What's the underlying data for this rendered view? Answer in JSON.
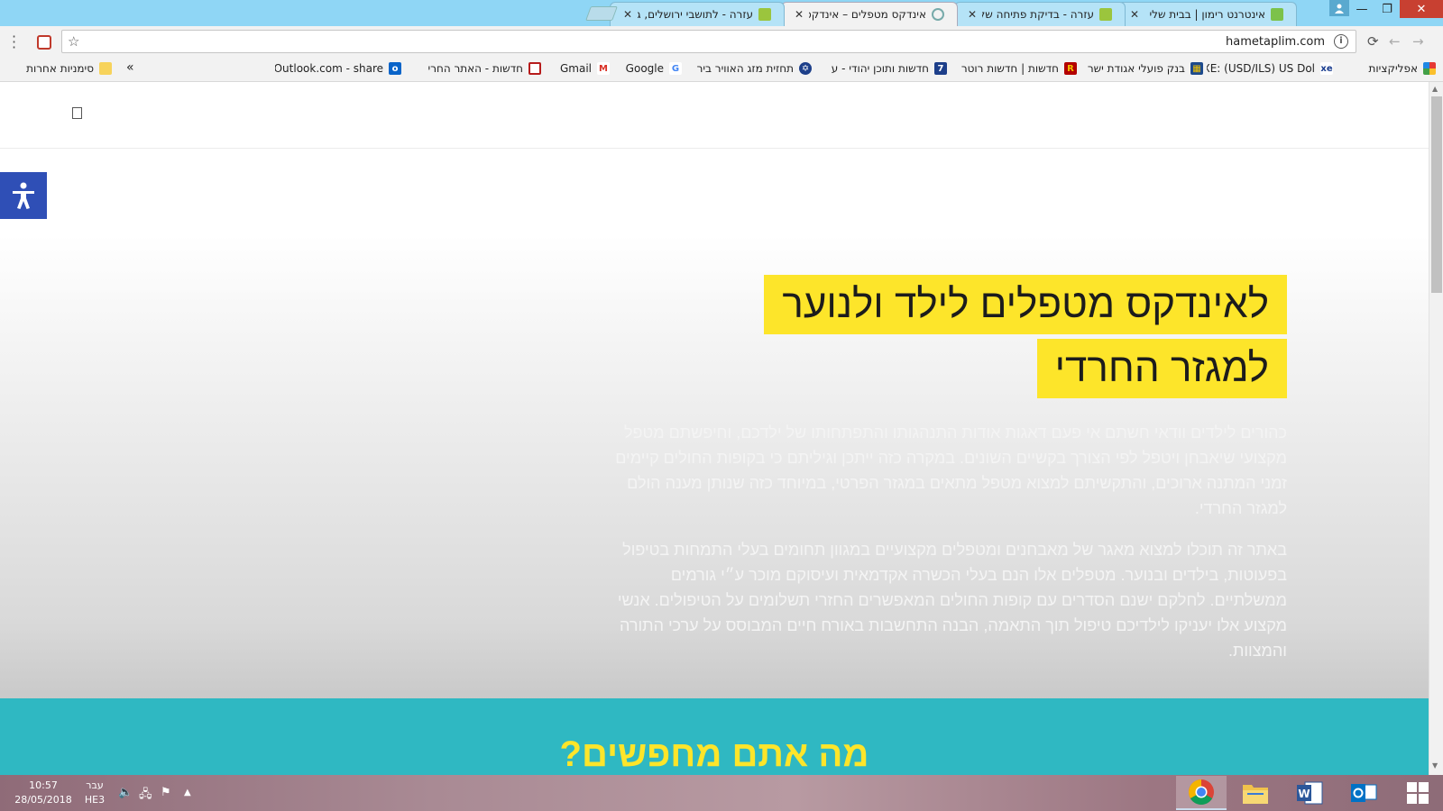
{
  "browser": {
    "tabs": [
      {
        "title": "אינטרנט רימון | בבית שלי"
      },
      {
        "title": "עזרה - בדיקת פתיחה של"
      },
      {
        "title": "אינדקס מטפלים – אינדקס"
      },
      {
        "title": "עזרה - לתושבי ירושלים, ג"
      }
    ],
    "close_glyph": "✕",
    "url": "hametaplim.com",
    "bookmarks": [
      {
        "label": "אפליקציות"
      },
      {
        "label": "XE: (USD/ILS) US Dol"
      },
      {
        "label": "בנק פועלי אגודת ישר"
      },
      {
        "label": "חדשות | חדשות רוטר"
      },
      {
        "label": "חדשות ותוכן יהודי - ע"
      },
      {
        "label": "תחזית מזג האוויר ביר"
      },
      {
        "label": "Google"
      },
      {
        "label": "Gmail"
      },
      {
        "label": "חדשות - האתר החרי"
      },
      {
        "label": "Outlook.com - share"
      }
    ],
    "bookmarks_overflow": "»",
    "other_bookmarks": "סימניות אחרות"
  },
  "page": {
    "headline_line1": "לאינדקס מטפלים לילד ולנוער",
    "headline_line2": "למגזר החרדי",
    "paragraph1": "כהורים לילדים וודאי חשתם אי פעם דאגות אודות התנהגותו והתפתחותו של ילדכם, וחיפשתם מטפל מקצועי שיאבחן ויטפל לפי הצורך בקשיים השונים. במקרה כזה ייתכן וגיליתם כי בקופות החולים קיימים זמני המתנה ארוכים, והתקשיתם למצוא מטפל מתאים במגזר הפרטי, במיוחד כזה שנותן מענה הולם למגזר החרדי.",
    "paragraph2": "באתר זה תוכלו למצוא מאגר של מאבחנים ומטפלים מקצועיים במגוון תחומים בעלי התמחות בטיפול בפעוטות, בילדים ובנוער. מטפלים אלו הנם בעלי הכשרה אקדמאית ועיסוקם מוכר ע״י גורמים ממשלתיים. לחלקם ישנם הסדרים עם קופות החולים המאפשרים החזרי תשלומים על הטיפולים. אנשי מקצוע אלו יעניקו לילדיכם טיפול תוך התאמה, הבנה התחשבות באורח חיים המבוסס על ערכי התורה והמצוות.",
    "section_title": "מה אתם מחפשים?"
  },
  "taskbar": {
    "time": "10:57",
    "date": "28/05/2018",
    "lang_top": "עבר",
    "lang_bottom": "HE3"
  },
  "colors": {
    "highlight": "#fde52a",
    "teal": "#2fb8c2",
    "accessibility": "#2f4fb6"
  }
}
